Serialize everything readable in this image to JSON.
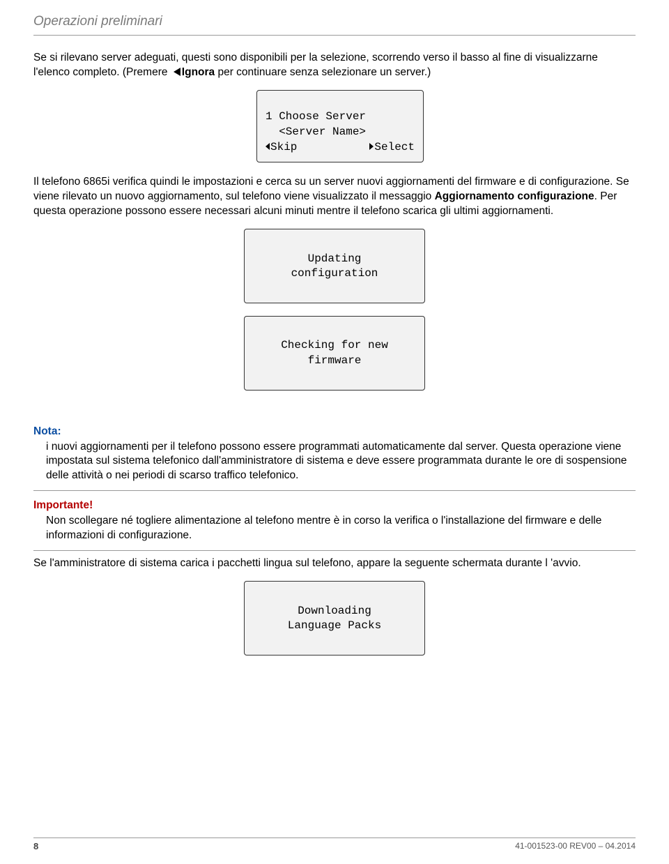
{
  "header": {
    "title": "Operazioni preliminari"
  },
  "para1": {
    "text_a": "Se si rilevano server adeguati, questi sono disponibili per la selezione, scorrendo verso il basso al fine di visualizzarne l'elenco completo. (Premere ",
    "bold_ignora": "Ignora",
    "text_b": " per continuare senza selezionare un server.)"
  },
  "screen1": {
    "line1": "1 Choose Server",
    "line2": "  <Server Name>",
    "skip": "Skip",
    "select": "Select"
  },
  "para2": {
    "text_a": "Il telefono 6865i verifica quindi le impostazioni e cerca su un server nuovi aggiornamenti del firmware e di configurazione. Se viene rilevato un nuovo aggiornamento, sul telefono viene visualizzato il messaggio ",
    "bold_agg": "Aggiornamento configurazione",
    "text_b": ". Per questa operazione possono essere necessari alcuni minuti mentre il telefono scarica gli ultimi aggiornamenti."
  },
  "screen2": {
    "line1": "Updating",
    "line2": "configuration"
  },
  "screen3": {
    "line1": "Checking for new",
    "line2": "firmware"
  },
  "note": {
    "title": "Nota:",
    "text": "i nuovi aggiornamenti per il telefono possono essere programmati automaticamente dal server. Questa operazione viene impostata sul sistema telefonico dall'amministratore di sistema e deve essere programmata durante le ore di sospensione delle attività o nei periodi di scarso traffico telefonico."
  },
  "important": {
    "title": "Importante!",
    "text": "Non scollegare né togliere alimentazione al telefono mentre è in corso la verifica o l'installazione del firmware e delle informazioni di configurazione."
  },
  "para3": {
    "text": "Se l'amministratore di sistema carica i pacchetti lingua sul telefono, appare la seguente schermata durante l 'avvio."
  },
  "screen4": {
    "line1": "Downloading",
    "line2": "Language Packs"
  },
  "footer": {
    "page": "8",
    "docid": "41-001523-00 REV00 – 04.2014"
  }
}
